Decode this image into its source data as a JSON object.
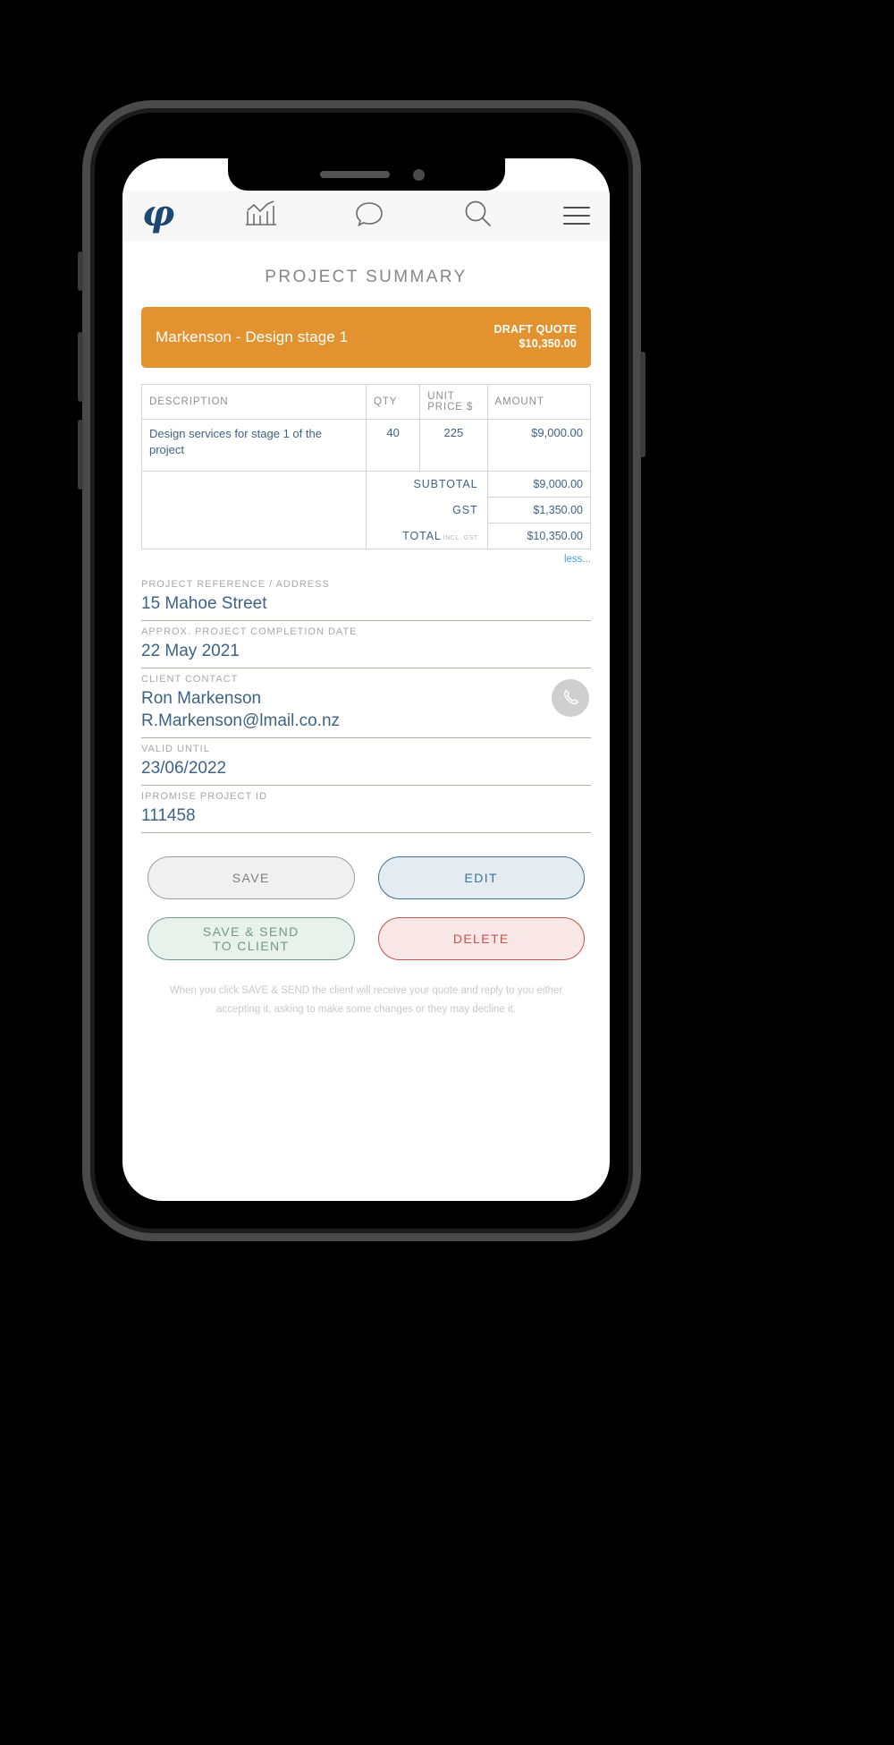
{
  "app": {
    "title": "PROJECT SUMMARY",
    "nav": [
      {
        "name": "logo",
        "icon": "leaf-logo-icon",
        "glyph": "φ"
      },
      {
        "name": "dashboard",
        "icon": "chart-icon"
      },
      {
        "name": "messages",
        "icon": "chat-bubble-icon"
      },
      {
        "name": "search",
        "icon": "search-icon"
      },
      {
        "name": "menu",
        "icon": "hamburger-menu-icon"
      }
    ]
  },
  "banner": {
    "project_name": "Markenson - Design stage 1",
    "status": "DRAFT QUOTE",
    "amount": "$10,350.00",
    "color": "#e2922f"
  },
  "table": {
    "headers": [
      "DESCRIPTION",
      "QTY",
      "UNIT PRICE $",
      "AMOUNT"
    ],
    "header_unit_line1": "UNIT",
    "header_unit_line2": "PRICE $",
    "rows": [
      {
        "description": "Design services for stage 1 of the project",
        "qty": "40",
        "unit_price": "225",
        "amount": "$9,000.00"
      }
    ],
    "totals": [
      {
        "label": "SUBTOTAL",
        "value": "$9,000.00"
      },
      {
        "label": "GST",
        "value": "$1,350.00"
      },
      {
        "label": "TOTAL",
        "sublabel": "INCL. GST",
        "value": "$10,350.00"
      }
    ],
    "less_link": "less..."
  },
  "fields": [
    {
      "label": "PROJECT REFERENCE / ADDRESS",
      "value": "15 Mahoe Street"
    },
    {
      "label": "APPROX. PROJECT COMPLETION DATE",
      "value": "22 May 2021"
    },
    {
      "label": "CLIENT CONTACT",
      "value": "Ron Markenson",
      "value2": "R.Markenson@lmail.co.nz",
      "badge_icon": "phone-icon"
    },
    {
      "label": "VALID UNTIL",
      "value": "23/06/2022"
    },
    {
      "label": "IPROMISE PROJECT ID",
      "value": "111458"
    }
  ],
  "buttons": {
    "save": "SAVE",
    "edit": "EDIT",
    "save_send_line1": "SAVE & SEND",
    "save_send_line2": "TO CLIENT",
    "delete": "DELETE"
  },
  "footer_note": "When you click SAVE & SEND the client will receive your quote and reply to you either accepting it, asking to make some changes or they may decline it."
}
